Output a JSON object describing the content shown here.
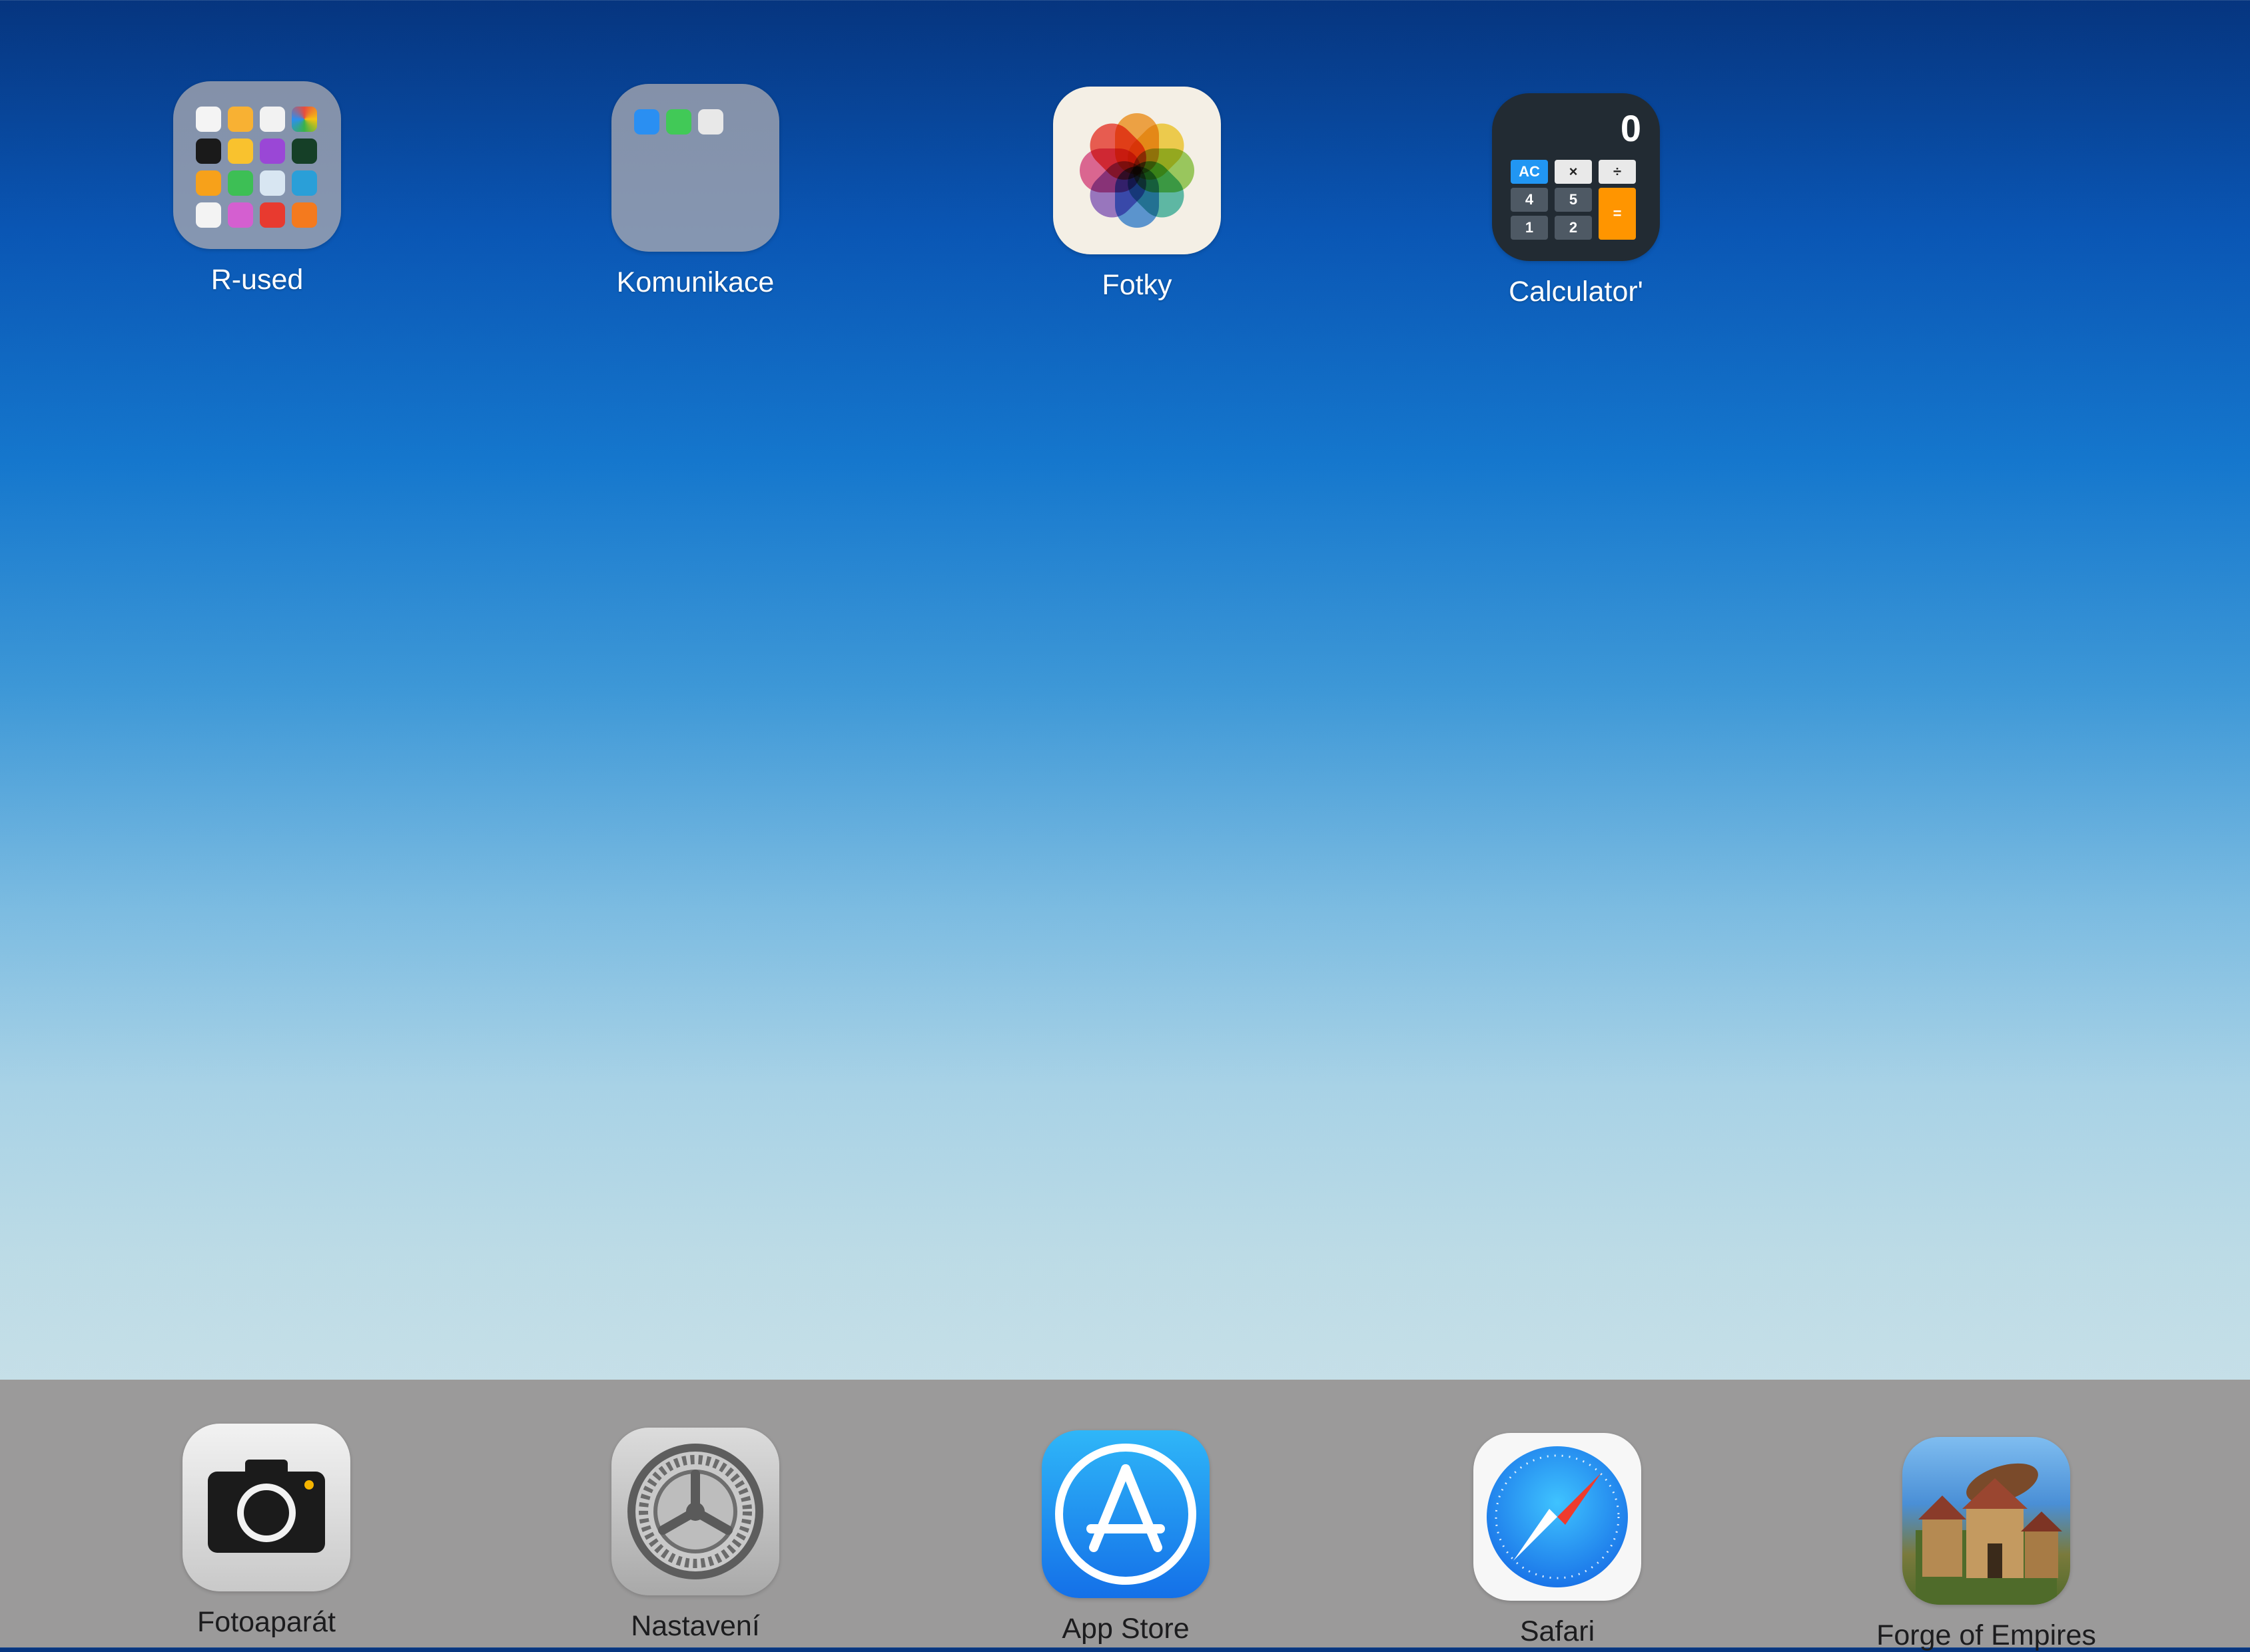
{
  "home_screen": {
    "apps": [
      {
        "label": "R-used",
        "icon": "folder-icon"
      },
      {
        "label": "Komunikace",
        "icon": "folder-icon"
      },
      {
        "label": "Fotky",
        "icon": "photos-icon"
      },
      {
        "label": "Calculator'",
        "icon": "calculator-icon"
      }
    ]
  },
  "calculator_icon": {
    "display": "0",
    "keys": [
      "AC",
      "×",
      "÷",
      "4",
      "5",
      "1",
      "2",
      "="
    ]
  },
  "dock": {
    "apps": [
      {
        "label": "Fotoaparát",
        "icon": "camera-icon"
      },
      {
        "label": "Nastavení",
        "icon": "settings-gear-icon"
      },
      {
        "label": "App Store",
        "icon": "app-store-icon"
      },
      {
        "label": "Safari",
        "icon": "safari-compass-icon"
      },
      {
        "label": "Forge of Empires",
        "icon": "forge-of-empires-icon"
      }
    ]
  },
  "colors": {
    "wallpaper_top": "#06357f",
    "wallpaper_bottom": "#cde2ea",
    "dock_background": "#9b9a9a",
    "calculator_operator": "#ff9500",
    "calculator_ac": "#2196f3"
  }
}
